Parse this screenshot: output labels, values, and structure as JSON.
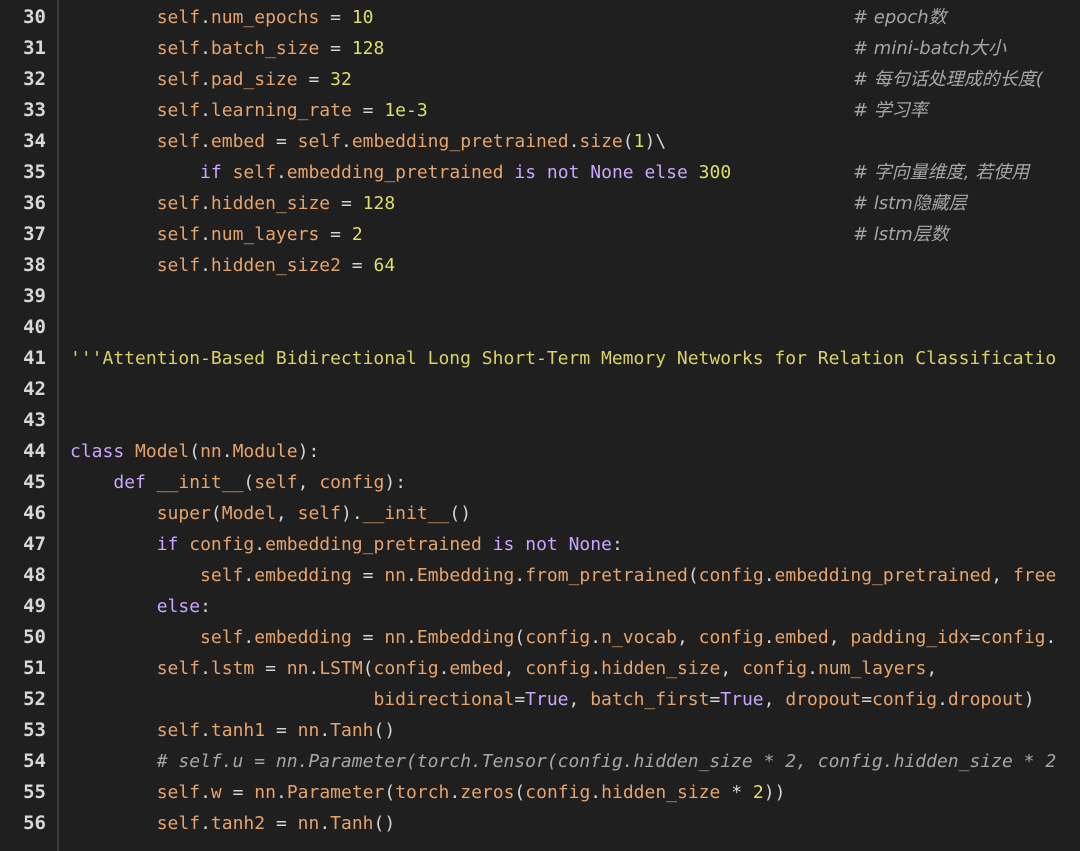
{
  "editor": {
    "lines": [
      {
        "n": "30",
        "code": "        self.num_epochs = 10",
        "comment": "# epoch数"
      },
      {
        "n": "31",
        "code": "        self.batch_size = 128",
        "comment": "# mini-batch大小"
      },
      {
        "n": "32",
        "code": "        self.pad_size = 32",
        "comment": "# 每句话处理成的长度("
      },
      {
        "n": "33",
        "code": "        self.learning_rate = 1e-3",
        "comment": "# 学习率"
      },
      {
        "n": "34",
        "code": "        self.embed = self.embedding_pretrained.size(1)\\",
        "comment": ""
      },
      {
        "n": "35",
        "code": "            if self.embedding_pretrained is not None else 300",
        "comment": "# 字向量维度, 若使用"
      },
      {
        "n": "36",
        "code": "        self.hidden_size = 128",
        "comment": "# lstm隐藏层"
      },
      {
        "n": "37",
        "code": "        self.num_layers = 2",
        "comment": "# lstm层数"
      },
      {
        "n": "38",
        "code": "        self.hidden_size2 = 64",
        "comment": ""
      },
      {
        "n": "39",
        "code": "",
        "comment": ""
      },
      {
        "n": "40",
        "code": "",
        "comment": ""
      },
      {
        "n": "41",
        "code": "'''Attention-Based Bidirectional Long Short-Term Memory Networks for Relation Classificatio",
        "comment": ""
      },
      {
        "n": "42",
        "code": "",
        "comment": ""
      },
      {
        "n": "43",
        "code": "",
        "comment": ""
      },
      {
        "n": "44",
        "code": "class Model(nn.Module):",
        "comment": ""
      },
      {
        "n": "45",
        "code": "    def __init__(self, config):",
        "comment": ""
      },
      {
        "n": "46",
        "code": "        super(Model, self).__init__()",
        "comment": ""
      },
      {
        "n": "47",
        "code": "        if config.embedding_pretrained is not None:",
        "comment": ""
      },
      {
        "n": "48",
        "code": "            self.embedding = nn.Embedding.from_pretrained(config.embedding_pretrained, free",
        "comment": ""
      },
      {
        "n": "49",
        "code": "        else:",
        "comment": ""
      },
      {
        "n": "50",
        "code": "            self.embedding = nn.Embedding(config.n_vocab, config.embed, padding_idx=config.",
        "comment": ""
      },
      {
        "n": "51",
        "code": "        self.lstm = nn.LSTM(config.embed, config.hidden_size, config.num_layers,",
        "comment": ""
      },
      {
        "n": "52",
        "code": "                            bidirectional=True, batch_first=True, dropout=config.dropout)",
        "comment": ""
      },
      {
        "n": "53",
        "code": "        self.tanh1 = nn.Tanh()",
        "comment": ""
      },
      {
        "n": "54",
        "code": "        # self.u = nn.Parameter(torch.Tensor(config.hidden_size * 2, config.hidden_size * 2",
        "comment": ""
      },
      {
        "n": "55",
        "code": "        self.w = nn.Parameter(torch.zeros(config.hidden_size * 2))",
        "comment": ""
      },
      {
        "n": "56",
        "code": "        self.tanh2 = nn.Tanh()",
        "comment": ""
      }
    ]
  }
}
